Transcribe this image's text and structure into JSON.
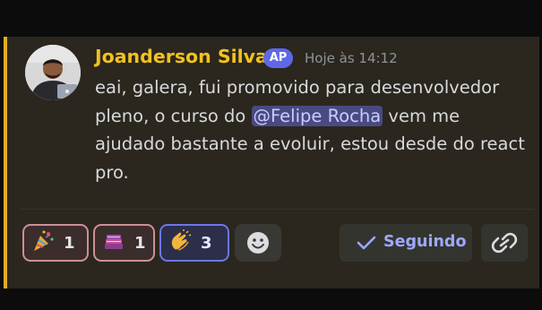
{
  "message": {
    "author": "Joanderson Silva",
    "badge": "AP",
    "timestamp": "Hoje às 14:12",
    "text_before": "eai, galera, fui promovido para desenvolvedor pleno, o curso do ",
    "mention": "@Felipe Rocha",
    "text_after": " vem me ajudado bastante a evoluir, estou desde do react pro.",
    "accent_color": "#e2ad24",
    "author_color": "#f2c21f",
    "mention_bg": "#494a82"
  },
  "reactions": [
    {
      "icon": "party-popper-icon",
      "count": "1"
    },
    {
      "icon": "books-icon",
      "count": "1"
    },
    {
      "icon": "clapping-hands-icon",
      "count": "3"
    }
  ],
  "actions": {
    "add_reaction_icon": "smiley-face-icon",
    "follow_icon": "checkmark-icon",
    "follow_label": "Seguindo",
    "copy_link_icon": "link-icon"
  }
}
